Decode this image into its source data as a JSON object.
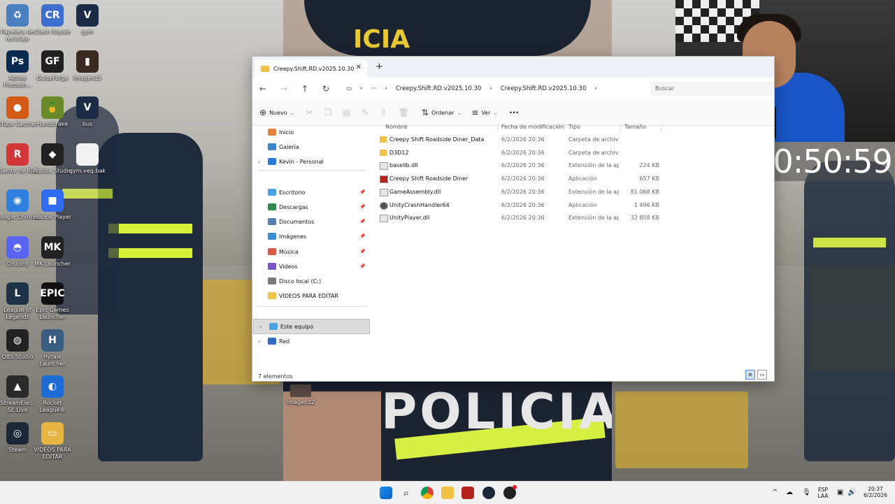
{
  "desktop": {
    "icons": [
      {
        "label": "Papelera de reciclaje",
        "glyph": "♻",
        "color": "#4a7fbf"
      },
      {
        "label": "Clash Royale",
        "glyph": "CR",
        "color": "#3e6fcf"
      },
      {
        "label": "gym",
        "glyph": "V",
        "color": "#1b2b45"
      },
      {
        "label": "Adobe Photosh...",
        "glyph": "Ps",
        "color": "#0b2a4f"
      },
      {
        "label": "GuiseForge",
        "glyph": "GF",
        "color": "#202020"
      },
      {
        "label": "Imagen15",
        "glyph": "▮",
        "color": "#3a2a22"
      },
      {
        "label": "aTube Catcher",
        "glyph": "●",
        "color": "#d35b16"
      },
      {
        "label": "HandBrake",
        "glyph": "🍍",
        "color": "#6a8a2a"
      },
      {
        "label": "bus",
        "glyph": "V",
        "color": "#1b2b45"
      },
      {
        "label": "Cliente de Riot",
        "glyph": "R",
        "color": "#d13639"
      },
      {
        "label": "Roblox Studio",
        "glyph": "◆",
        "color": "#222"
      },
      {
        "label": "gym.veg.bak",
        "glyph": "",
        "color": "#f2f2f2"
      },
      {
        "label": "Google Chrome",
        "glyph": "◉",
        "color": "#2f7fe0"
      },
      {
        "label": "Roblox Player",
        "glyph": "■",
        "color": "#2f6cf0"
      },
      {
        "label": "Discord",
        "glyph": "◓",
        "color": "#5865f2"
      },
      {
        "label": "MK Launcher",
        "glyph": "MK",
        "color": "#222"
      },
      {
        "label": "League of Legends",
        "glyph": "L",
        "color": "#1e3347"
      },
      {
        "label": "Epic Games Launcher",
        "glyph": "EPIC",
        "color": "#111"
      },
      {
        "label": "OBS Studio",
        "glyph": "◍",
        "color": "#222"
      },
      {
        "label": "Hytale Launcher",
        "glyph": "H",
        "color": "#3c5d82"
      },
      {
        "label": "StreamEle... SE.Live",
        "glyph": "▲",
        "color": "#2a2a2a"
      },
      {
        "label": "Rocket League®",
        "glyph": "◐",
        "color": "#1d6bd4"
      },
      {
        "label": "Steam",
        "glyph": "◎",
        "color": "#1b2838"
      },
      {
        "label": "VIDEOS PARA EDITAR",
        "glyph": "▭",
        "color": "#e6b544"
      }
    ],
    "floating_icon": {
      "label": "Imagen22"
    }
  },
  "overlay": {
    "clock_text": "10:50:59",
    "shirt_text_bottom": "POLICIA",
    "shirt_text_top": "ICIA"
  },
  "explorer": {
    "tab_title": "Creepy.Shift.RD.v2025.10.30",
    "new_tab": "+",
    "breadcrumb": [
      "Creepy.Shift.RD.v2025.10.30",
      "Creepy.Shift.RD.v2025.10.30"
    ],
    "search_placeholder": "Buscar",
    "toolbar": {
      "new_label": "Nuevo",
      "sort_label": "Ordenar",
      "view_label": "Ver",
      "more": "···"
    },
    "nav_items": [
      {
        "label": "Inicio",
        "color": "#e3823a"
      },
      {
        "label": "Galería",
        "color": "#3b82c8"
      },
      {
        "label": "Kevin - Personal",
        "color": "#2a7bd6"
      },
      {
        "label": "Escritorio",
        "color": "#4aa3e0"
      },
      {
        "label": "Descargas",
        "color": "#2c8b4d"
      },
      {
        "label": "Documentos",
        "color": "#5a7fae"
      },
      {
        "label": "Imágenes",
        "color": "#3a8bd0"
      },
      {
        "label": "Música",
        "color": "#d75a4a"
      },
      {
        "label": "Videos",
        "color": "#7a53c8"
      },
      {
        "label": "Disco local (C:)",
        "color": "#7a7a7a"
      },
      {
        "label": "VIDEOS PARA EDITAR",
        "color": "#f0c14b"
      },
      {
        "label": "Este equipo",
        "color": "#4aa3e0"
      },
      {
        "label": "Red",
        "color": "#2f6cc4"
      }
    ],
    "columns": {
      "name": "Nombre",
      "modified": "Fecha de modificación",
      "type": "Tipo",
      "size": "Tamaño"
    },
    "files": [
      {
        "name": "Creepy Shift Roadside Diner_Data",
        "modified": "6/2/2026 20:36",
        "type": "Carpeta de archivos",
        "size": "",
        "icon": "folder"
      },
      {
        "name": "D3D12",
        "modified": "6/2/2026 20:36",
        "type": "Carpeta de archivos",
        "size": "",
        "icon": "folder"
      },
      {
        "name": "baselib.dll",
        "modified": "6/2/2026 20:36",
        "type": "Extensión de la apl...",
        "size": "224 KB",
        "icon": "dll"
      },
      {
        "name": "Creepy Shift Roadside Diner",
        "modified": "6/2/2026 20:36",
        "type": "Aplicación",
        "size": "657 KB",
        "icon": "app"
      },
      {
        "name": "GameAssembly.dll",
        "modified": "6/2/2026 20:36",
        "type": "Extensión de la apl...",
        "size": "81 068 KB",
        "icon": "dll"
      },
      {
        "name": "UnityCrashHandler64",
        "modified": "6/2/2026 20:36",
        "type": "Aplicación",
        "size": "1 496 KB",
        "icon": "unity"
      },
      {
        "name": "UnityPlayer.dll",
        "modified": "6/2/2026 20:36",
        "type": "Extensión de la apl...",
        "size": "32 858 KB",
        "icon": "dll"
      }
    ],
    "status_text": "7 elementos"
  },
  "taskbar": {
    "tray_lang": "ESP",
    "tray_region": "LAA",
    "time": "20:37",
    "date": "6/2/2026",
    "overflow": "^"
  }
}
